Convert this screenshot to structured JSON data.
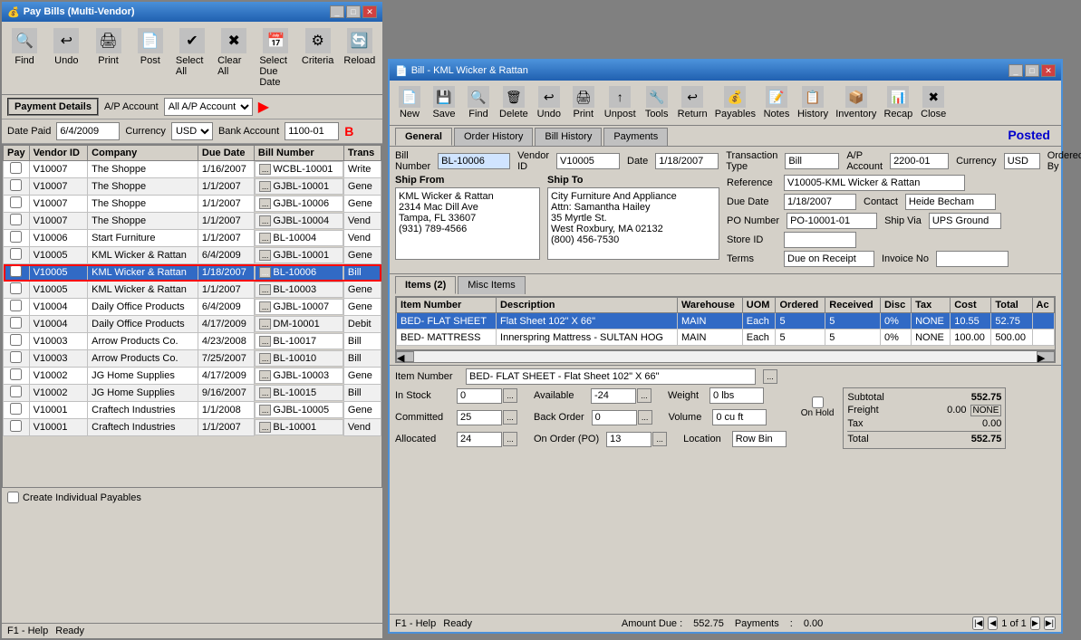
{
  "mainWindow": {
    "title": "Pay Bills (Multi-Vendor)",
    "toolbar": {
      "buttons": [
        {
          "id": "find",
          "label": "Find",
          "icon": "🔍"
        },
        {
          "id": "undo",
          "label": "Undo",
          "icon": "↩"
        },
        {
          "id": "print",
          "label": "Print",
          "icon": "🖨"
        },
        {
          "id": "post",
          "label": "Post",
          "icon": "📄"
        },
        {
          "id": "select-all",
          "label": "Select All",
          "icon": "✔"
        },
        {
          "id": "clear-all",
          "label": "Clear All",
          "icon": "✖"
        },
        {
          "id": "select-due",
          "label": "Select Due Date",
          "icon": "📅"
        },
        {
          "id": "criteria",
          "label": "Criteria",
          "icon": "⚙"
        },
        {
          "id": "reload",
          "label": "Reload",
          "icon": "🔄"
        }
      ]
    },
    "form": {
      "payment_details_label": "Payment Details",
      "ap_account_label": "A/P Account",
      "ap_account_value": "All A/P Account",
      "date_paid_label": "Date Paid",
      "date_paid_value": "6/4/2009",
      "currency_label": "Currency",
      "currency_value": "USD",
      "bank_account_label": "Bank Account",
      "bank_account_value": "1100-01"
    },
    "table": {
      "columns": [
        "Pay",
        "Vendor ID",
        "Company",
        "Due Date",
        "Bill Number",
        "Trans"
      ],
      "rows": [
        {
          "pay": false,
          "vendor_id": "V10007",
          "company": "The Shoppe",
          "due_date": "1/16/2007",
          "bill_number": "WCBL-10001",
          "trans": "Write"
        },
        {
          "pay": false,
          "vendor_id": "V10007",
          "company": "The Shoppe",
          "due_date": "1/1/2007",
          "bill_number": "GJBL-10001",
          "trans": "Gene"
        },
        {
          "pay": false,
          "vendor_id": "V10007",
          "company": "The Shoppe",
          "due_date": "1/1/2007",
          "bill_number": "GJBL-10006",
          "trans": "Gene"
        },
        {
          "pay": false,
          "vendor_id": "V10007",
          "company": "The Shoppe",
          "due_date": "1/1/2007",
          "bill_number": "GJBL-10004",
          "trans": "Vend"
        },
        {
          "pay": false,
          "vendor_id": "V10006",
          "company": "Start Furniture",
          "due_date": "1/1/2007",
          "bill_number": "BL-10004",
          "trans": "Vend"
        },
        {
          "pay": false,
          "vendor_id": "V10005",
          "company": "KML Wicker & Rattan",
          "due_date": "6/4/2009",
          "bill_number": "GJBL-10001",
          "trans": "Gene"
        },
        {
          "pay": false,
          "vendor_id": "V10005",
          "company": "KML Wicker & Rattan",
          "due_date": "1/18/2007",
          "bill_number": "BL-10006",
          "trans": "Bill",
          "selected": true,
          "highlighted": true
        },
        {
          "pay": false,
          "vendor_id": "V10005",
          "company": "KML Wicker & Rattan",
          "due_date": "1/1/2007",
          "bill_number": "BL-10003",
          "trans": "Gene"
        },
        {
          "pay": false,
          "vendor_id": "V10004",
          "company": "Daily Office Products",
          "due_date": "6/4/2009",
          "bill_number": "GJBL-10007",
          "trans": "Gene"
        },
        {
          "pay": false,
          "vendor_id": "V10004",
          "company": "Daily Office Products",
          "due_date": "4/17/2009",
          "bill_number": "DM-10001",
          "trans": "Debit"
        },
        {
          "pay": false,
          "vendor_id": "V10003",
          "company": "Arrow Products Co.",
          "due_date": "4/23/2008",
          "bill_number": "BL-10017",
          "trans": "Bill"
        },
        {
          "pay": false,
          "vendor_id": "V10003",
          "company": "Arrow Products Co.",
          "due_date": "7/25/2007",
          "bill_number": "BL-10010",
          "trans": "Bill"
        },
        {
          "pay": false,
          "vendor_id": "V10002",
          "company": "JG Home Supplies",
          "due_date": "4/17/2009",
          "bill_number": "GJBL-10003",
          "trans": "Gene"
        },
        {
          "pay": false,
          "vendor_id": "V10002",
          "company": "JG Home Supplies",
          "due_date": "9/16/2007",
          "bill_number": "BL-10015",
          "trans": "Bill"
        },
        {
          "pay": false,
          "vendor_id": "V10001",
          "company": "Craftech Industries",
          "due_date": "1/1/2008",
          "bill_number": "GJBL-10005",
          "trans": "Gene"
        },
        {
          "pay": false,
          "vendor_id": "V10001",
          "company": "Craftech Industries",
          "due_date": "1/1/2007",
          "bill_number": "BL-10001",
          "trans": "Vend"
        }
      ]
    },
    "create_individual": "Create Individual Payables",
    "status": {
      "f1_help": "F1 - Help",
      "ready": "Ready"
    }
  },
  "billWindow": {
    "title": "Bill - KML Wicker & Rattan",
    "toolbar": {
      "buttons": [
        {
          "id": "new",
          "label": "New",
          "icon": "📄"
        },
        {
          "id": "save",
          "label": "Save",
          "icon": "💾"
        },
        {
          "id": "find",
          "label": "Find",
          "icon": "🔍"
        },
        {
          "id": "delete",
          "label": "Delete",
          "icon": "🗑"
        },
        {
          "id": "undo",
          "label": "Undo",
          "icon": "↩"
        },
        {
          "id": "print",
          "label": "Print",
          "icon": "🖨"
        },
        {
          "id": "unpost",
          "label": "Unpost",
          "icon": "↑"
        },
        {
          "id": "tools",
          "label": "Tools",
          "icon": "🔧"
        },
        {
          "id": "return",
          "label": "Return",
          "icon": "↩"
        },
        {
          "id": "payables",
          "label": "Payables",
          "icon": "💰"
        },
        {
          "id": "notes",
          "label": "Notes",
          "icon": "📝"
        },
        {
          "id": "history",
          "label": "History",
          "icon": "📋"
        },
        {
          "id": "inventory",
          "label": "Inventory",
          "icon": "📦"
        },
        {
          "id": "recap",
          "label": "Recap",
          "icon": "📊"
        },
        {
          "id": "close",
          "label": "Close",
          "icon": "✖"
        }
      ]
    },
    "tabs": [
      "General",
      "Order History",
      "Bill History",
      "Payments"
    ],
    "active_tab": "General",
    "posted_label": "Posted",
    "form": {
      "bill_number_label": "Bill Number",
      "bill_number_value": "BL-10006",
      "vendor_id_label": "Vendor ID",
      "vendor_id_value": "V10005",
      "date_label": "Date",
      "date_value": "1/18/2007",
      "transaction_type_label": "Transaction Type",
      "transaction_type_value": "Bill",
      "ap_account_label": "A/P Account",
      "ap_account_value": "2200-01",
      "currency_label": "Currency",
      "currency_value": "USD",
      "ordered_by_label": "Ordered By",
      "ordered_by_value": "",
      "reference_label": "Reference",
      "reference_value": "V10005-KML Wicker & Rattan",
      "due_date_label": "Due Date",
      "due_date_value": "1/18/2007",
      "contact_label": "Contact",
      "contact_value": "Heide Becham",
      "po_number_label": "PO Number",
      "po_number_value": "PO-10001-01",
      "ship_via_label": "Ship Via",
      "ship_via_value": "UPS Ground",
      "store_id_label": "Store ID",
      "store_id_value": "",
      "terms_label": "Terms",
      "terms_value": "Due on Receipt",
      "invoice_no_label": "Invoice No",
      "invoice_no_value": ""
    },
    "ship_from": {
      "label": "Ship From",
      "name": "KML Wicker & Rattan",
      "address1": "2314 Mac Dill Ave",
      "address2": "Tampa, FL 33607",
      "phone": "(931) 789-4566"
    },
    "ship_to": {
      "label": "Ship To",
      "name": "City Furniture And Appliance",
      "attn": "Attn: Samantha Hailey",
      "address1": "35 Myrtle St.",
      "address2": "West Roxbury, MA 02132",
      "phone": "(800) 456-7530"
    },
    "items_tab": {
      "label": "Items (2)",
      "misc_label": "Misc Items",
      "columns": [
        "Item Number",
        "Description",
        "Warehouse",
        "UOM",
        "Ordered",
        "Received",
        "Disc",
        "Tax",
        "Cost",
        "Total",
        "Ac"
      ],
      "rows": [
        {
          "item_number": "BED- FLAT SHEET",
          "description": "Flat Sheet 102\" X 66\"",
          "warehouse": "MAIN",
          "uom": "Each",
          "ordered": 5,
          "received": 5,
          "disc": "0%",
          "tax": "NONE",
          "cost": "10.55",
          "total": "52.75",
          "selected": true
        },
        {
          "item_number": "BED- MATTRESS",
          "description": "Innerspring Mattress - SULTAN HOG",
          "warehouse": "MAIN",
          "uom": "Each",
          "ordered": 5,
          "received": 5,
          "disc": "0%",
          "tax": "NONE",
          "cost": "100.00",
          "total": "500.00"
        }
      ]
    },
    "item_detail": {
      "item_number_label": "Item Number",
      "item_number_value": "BED- FLAT SHEET - Flat Sheet 102\" X 66\"",
      "in_stock_label": "In Stock",
      "in_stock_value": "0",
      "available_label": "Available",
      "available_value": "-24",
      "weight_label": "Weight",
      "weight_value": "0 lbs",
      "committed_label": "Committed",
      "committed_value": "25",
      "back_order_label": "Back Order",
      "back_order_value": "0",
      "volume_label": "Volume",
      "volume_value": "0 cu ft",
      "on_hold_label": "On Hold",
      "allocated_label": "Allocated",
      "allocated_value": "24",
      "on_order_label": "On Order (PO)",
      "on_order_value": "13",
      "location_label": "Location",
      "location_value": "Row Bin"
    },
    "totals": {
      "subtotal_label": "Subtotal",
      "subtotal_value": "552.75",
      "freight_label": "Freight",
      "freight_value": "0.00",
      "none_label": "NONE",
      "tax_label": "Tax",
      "tax_value": "0.00",
      "total_label": "Total",
      "total_value": "552.75"
    },
    "status": {
      "f1_help": "F1 - Help",
      "ready": "Ready",
      "amount_due_label": "Amount Due",
      "amount_due_value": "552.75",
      "payments_label": "Payments",
      "payments_value": "0.00",
      "page_label": "1 of 1"
    }
  }
}
